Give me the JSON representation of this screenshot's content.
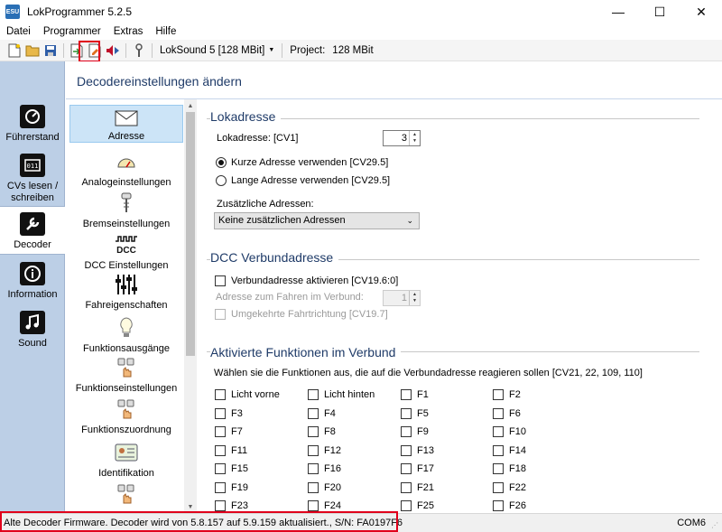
{
  "window": {
    "title": "LokProgrammer 5.2.5",
    "icon_text": "ESU",
    "minimize": "—",
    "maximize": "☐",
    "close": "✕"
  },
  "menu": [
    "Datei",
    "Programmer",
    "Extras",
    "Hilfe"
  ],
  "toolbar": {
    "device": "LokSound 5 [128 MBit]",
    "project_label": "Project:",
    "project_value": "128 MBit"
  },
  "nav": [
    {
      "label": "Führerstand",
      "icon": "tachometer-icon"
    },
    {
      "label": "CVs lesen / schreiben",
      "icon": "cv-chip-icon"
    },
    {
      "label": "Decoder",
      "icon": "wrench-icon"
    },
    {
      "label": "Information",
      "icon": "info-icon"
    },
    {
      "label": "Sound",
      "icon": "music-note-icon"
    }
  ],
  "header": {
    "title": "Decodereinstellungen ändern"
  },
  "categories": [
    {
      "label": "Adresse",
      "icon": "envelope-icon"
    },
    {
      "label": "Analogeinstellungen",
      "icon": "gauge-icon"
    },
    {
      "label": "Bremseinstellungen",
      "icon": "brake-icon"
    },
    {
      "label": "DCC Einstellungen",
      "icon": "dcc-icon"
    },
    {
      "label": "Fahreigenschaften",
      "icon": "sliders-icon"
    },
    {
      "label": "Funktionsausgänge",
      "icon": "bulb-icon"
    },
    {
      "label": "Funktionseinstellungen",
      "icon": "hand-buttons-icon"
    },
    {
      "label": "Funktionszuordnung",
      "icon": "hand-buttons-icon"
    },
    {
      "label": "Identifikation",
      "icon": "id-card-icon"
    },
    {
      "label": "",
      "icon": "hand-buttons-icon"
    }
  ],
  "lokadresse": {
    "title": "Lokadresse",
    "address_label": "Lokadresse: [CV1]",
    "address_value": "3",
    "short_label": "Kurze Adresse verwenden [CV29.5]",
    "long_label": "Lange Adresse verwenden [CV29.5]",
    "extra_label": "Zusätzliche Adressen:",
    "extra_value": "Keine zusätzlichen Adressen"
  },
  "verbund": {
    "title": "DCC Verbundadresse",
    "activate_label": "Verbundadresse aktivieren [CV19.6:0]",
    "address_label": "Adresse zum Fahren im Verbund:",
    "address_value": "1",
    "reverse_label": "Umgekehrte Fahrtrichtung [CV19.7]"
  },
  "functions": {
    "title": "Aktivierte Funktionen im Verbund",
    "instruction": "Wählen sie die Funktionen aus, die auf die Verbundadresse reagieren sollen [CV21, 22, 109, 110]",
    "items": [
      "Licht vorne",
      "Licht hinten",
      "F1",
      "F2",
      "F3",
      "F4",
      "F5",
      "F6",
      "F7",
      "F8",
      "F9",
      "F10",
      "F11",
      "F12",
      "F13",
      "F14",
      "F15",
      "F16",
      "F17",
      "F18",
      "F19",
      "F20",
      "F21",
      "F22",
      "F23",
      "F24",
      "F25",
      "F26"
    ]
  },
  "status": {
    "message": "Alte Decoder Firmware. Decoder wird von 5.8.157 auf 5.9.159 aktualisiert., S/N: FA0197F6",
    "port": "COM6"
  }
}
